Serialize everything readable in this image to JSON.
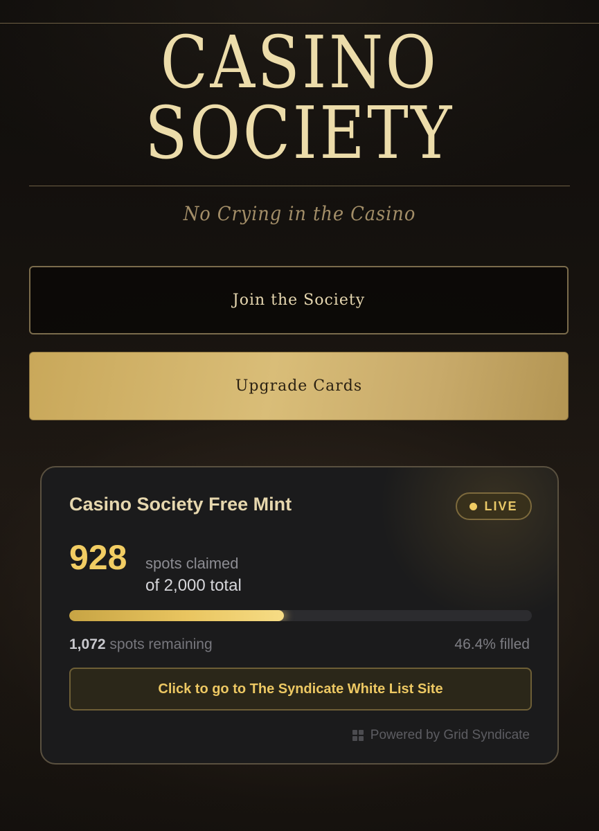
{
  "brand": {
    "title_line1": "CASINO",
    "title_line2": "SOCIETY",
    "tagline": "No Crying in the Casino"
  },
  "buttons": {
    "join_label": "Join the Society",
    "upgrade_label": "Upgrade Cards"
  },
  "mint_card": {
    "title": "Casino Society Free Mint",
    "status_badge": "LIVE",
    "claimed_count": "928",
    "claimed_label": "spots claimed",
    "total_label": "of 2,000 total",
    "progress_fraction": 0.464,
    "remaining_count": "1,072",
    "remaining_label": "spots remaining",
    "filled_label": "46.4% filled",
    "whitelist_button_label": "Click to go to The Syndicate White List Site",
    "powered_by": "Powered by Grid Syndicate",
    "powered_by_icon": "grid-icon"
  },
  "colors": {
    "accent_gold": "#f2cd63",
    "brand_cream": "#ecdcaa",
    "upgrade_button_gold": "#d9bd78"
  }
}
